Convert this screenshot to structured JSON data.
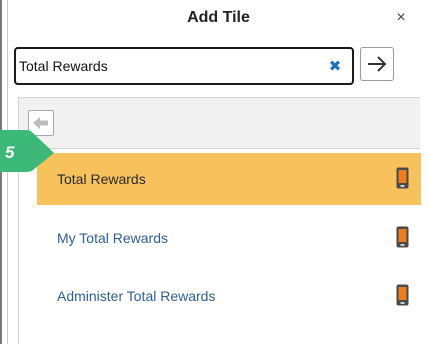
{
  "header": {
    "title": "Add Tile",
    "close_icon": "close-icon",
    "close_glyph": "×"
  },
  "search": {
    "value": "Total Rewards",
    "clear_icon": "clear-x-icon",
    "clear_glyph": "✖",
    "go_icon": "arrow-right-icon"
  },
  "toolbar": {
    "back_icon": "arrow-left-icon"
  },
  "results": [
    {
      "label": "Total Rewards",
      "selected": true,
      "icon": "mobile-device-icon"
    },
    {
      "label": "My Total Rewards",
      "selected": false,
      "icon": "mobile-device-icon"
    },
    {
      "label": "Administer Total Rewards",
      "selected": false,
      "icon": "mobile-device-icon"
    }
  ],
  "callout": {
    "step": "5"
  },
  "colors": {
    "selected_row": "#f7c25c",
    "link_text": "#2e5f97",
    "callout_green": "#3cb878",
    "clear_icon": "#1f6fb8",
    "device_orange": "#ef7d1d"
  }
}
